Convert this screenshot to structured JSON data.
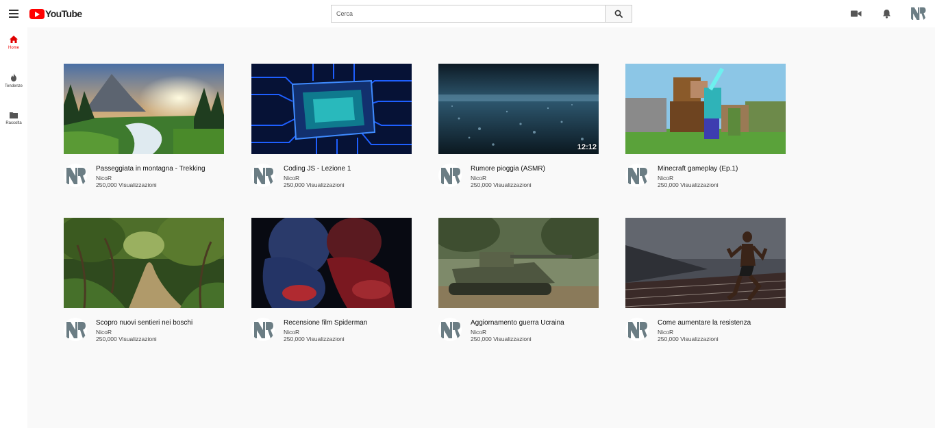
{
  "header": {
    "logo_text": "YouTube",
    "search_placeholder": "Cerca"
  },
  "sidebar": {
    "items": [
      {
        "label": "Home",
        "icon": "home-icon",
        "active": true
      },
      {
        "label": "Tendenze",
        "icon": "flame-icon",
        "active": false
      },
      {
        "label": "Raccolta",
        "icon": "folder-icon",
        "active": false
      }
    ]
  },
  "videos": [
    {
      "title": "Passeggiata in montagna - Trekking",
      "channel": "NicoR",
      "views": "250,000 Visualizzazioni",
      "duration": ""
    },
    {
      "title": "Coding JS - Lezione 1",
      "channel": "NicoR",
      "views": "250,000 Visualizzazioni",
      "duration": ""
    },
    {
      "title": "Rumore pioggia (ASMR)",
      "channel": "NicoR",
      "views": "250,000 Visualizzazioni",
      "duration": "12:12"
    },
    {
      "title": "Minecraft gameplay (Ep.1)",
      "channel": "NicoR",
      "views": "250,000 Visualizzazioni",
      "duration": ""
    },
    {
      "title": "Scopro nuovi sentieri nei boschi",
      "channel": "NicoR",
      "views": "250,000 Visualizzazioni",
      "duration": ""
    },
    {
      "title": "Recensione film Spiderman",
      "channel": "NicoR",
      "views": "250,000 Visualizzazioni",
      "duration": ""
    },
    {
      "title": "Aggiornamento guerra Ucraina",
      "channel": "NicoR",
      "views": "250,000 Visualizzazioni",
      "duration": ""
    },
    {
      "title": "Come aumentare la resistenza",
      "channel": "NicoR",
      "views": "250,000 Visualizzazioni",
      "duration": ""
    }
  ],
  "colors": {
    "brand_red": "#ff0000",
    "active_sidebar": "#e00000",
    "avatar_gray": "#6b7d84"
  }
}
